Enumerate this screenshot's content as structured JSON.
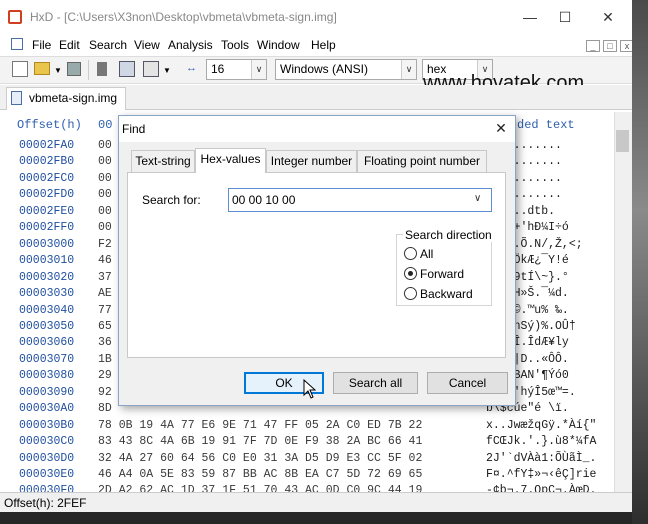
{
  "window": {
    "title": "HxD - [C:\\Users\\X3non\\Desktop\\vbmeta\\vbmeta-sign.img]"
  },
  "menu": [
    "File",
    "Edit",
    "Search",
    "View",
    "Analysis",
    "Tools",
    "Window",
    "Help"
  ],
  "toolbar": {
    "bytes_per_row": "16",
    "charset": "Windows (ANSI)",
    "offset_base": "hex"
  },
  "watermark": "www.hovatek.com",
  "tabs": {
    "file": "vbmeta-sign.img"
  },
  "hex_view": {
    "offset_header": "Offset(h)",
    "first_col_header": "00",
    "text_header": "ded text",
    "offsets": [
      "00002FA0",
      "00002FB0",
      "00002FC0",
      "00002FD0",
      "00002FE0",
      "00002FF0",
      "00003000",
      "00003010",
      "00003020",
      "00003030",
      "00003040",
      "00003050",
      "00003060",
      "00003070",
      "00003080",
      "00003090",
      "000030A0",
      "000030B0",
      "000030C0",
      "000030D0",
      "000030E0",
      "000030F0"
    ],
    "first_col": [
      "00",
      "00",
      "00",
      "00",
      "00",
      "00",
      "F2",
      "46",
      "37",
      "AE",
      "77",
      "65",
      "36",
      "1B",
      "29",
      "92",
      "8D",
      "78",
      "83",
      "32",
      "46",
      "2D"
    ],
    "full_rows": [
      "78 0B 19 4A 77 E6 9E 71 47 FF 05 2A C0 ED 7B 22",
      "83 43 8C 4A 6B 19 91 7F 7D 0E F9 38 2A BC 66 41",
      "32 4A 27 60 64 56 C0 E0 31 3A D5 D9 E3 CC 5F 02",
      "46 A4 0A 5E 83 59 87 BB AC 8B EA C7 5D 72 69 65",
      "2D A2 62 AC 1D 37 1F 51 70 43 AC 0D C0 9C 44 19"
    ],
    "text_col": [
      "...........",
      "...........",
      "...........",
      "...........",
      "......dtb.",
      "áxÛµ+'hÐ¼I÷ó",
      ".....Õ.N/,Ž,<;",
      "\"9+ÂÖkÆ¿¯Y!é",
      "Ð\"q*9tÍ\\~}.°",
      "3ÑtËH»Š.¯¼d.",
      "»?¢®©.™u% ‰.",
      "...unSý)%.OÛ†",
      "å.$dÎ.ÎdÆ¥ly",
      "ùOf/|D..«ÔÔ.",
      "O[rbBAN'¶Ýó0",
      "íiå£'hýÎ5œ™=.",
      "b\\$cúe\"é \\ï.",
      "x..JwæžqGÿ.*Àí{\"",
      "fCŒJk.'.}.ù8*¼fA",
      "2J'`dVÀà1:ÕÙãÌ_.",
      "F¤.^fY‡»¬‹êÇ]rie",
      "-¢b¬.7.QpC¬.ÀœD."
    ]
  },
  "status": {
    "offset": "Offset(h): 2FEF"
  },
  "find_dialog": {
    "title": "Find",
    "tabs": [
      "Text-string",
      "Hex-values",
      "Integer number",
      "Floating point number"
    ],
    "active_tab": "Hex-values",
    "search_label": "Search for:",
    "search_value": "00 00 10 00",
    "direction_legend": "Search direction",
    "directions": [
      "All",
      "Forward",
      "Backward"
    ],
    "selected_direction": "Forward",
    "buttons": {
      "ok": "OK",
      "search_all": "Search all",
      "cancel": "Cancel"
    }
  }
}
